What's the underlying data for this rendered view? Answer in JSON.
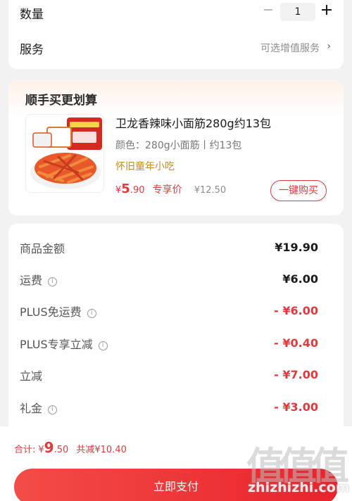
{
  "quantity": {
    "label": "数量",
    "value": "1"
  },
  "service": {
    "label": "服务",
    "value": "可选增值服务",
    "chevron": "›"
  },
  "bundle": {
    "title": "顺手买更划算",
    "product": {
      "name": "卫龙香辣味小面筋280g约13包",
      "spec": "颜色：280g小面筋丨约13包",
      "tag": "怀旧童年小吃",
      "price_yen": "¥",
      "price_int": "5",
      "price_dec": ".90",
      "price_label": "专享价",
      "original_price": "¥12.50",
      "buy_label": "一键购买",
      "image_icon": "spicy-gluten-snack-image"
    }
  },
  "fees": [
    {
      "label": "商品金额",
      "value": "¥19.90",
      "info": false,
      "red": false
    },
    {
      "label": "运费",
      "value": "¥6.00",
      "info": true,
      "red": false
    },
    {
      "label": "PLUS免运费",
      "value": "- ¥6.00",
      "info": true,
      "red": true
    },
    {
      "label": "PLUS专享立减",
      "value": "- ¥0.40",
      "info": true,
      "red": true
    },
    {
      "label": "立减",
      "value": "- ¥7.00",
      "info": false,
      "red": true
    },
    {
      "label": "礼金",
      "value": "- ¥3.00",
      "info": true,
      "red": true
    }
  ],
  "footer": {
    "total_label": "合计:",
    "total_yen": "¥",
    "total_int": "9",
    "total_dec": ".50",
    "saved": "共减¥10.40",
    "pay_label": "立即支付"
  },
  "watermark": {
    "glyphs": [
      "值",
      "值",
      "值"
    ],
    "url": "zhizhizhi.com"
  },
  "colors": {
    "accent": "#e4393c",
    "tag": "#c88a1c",
    "background": "#f2f2f2"
  }
}
